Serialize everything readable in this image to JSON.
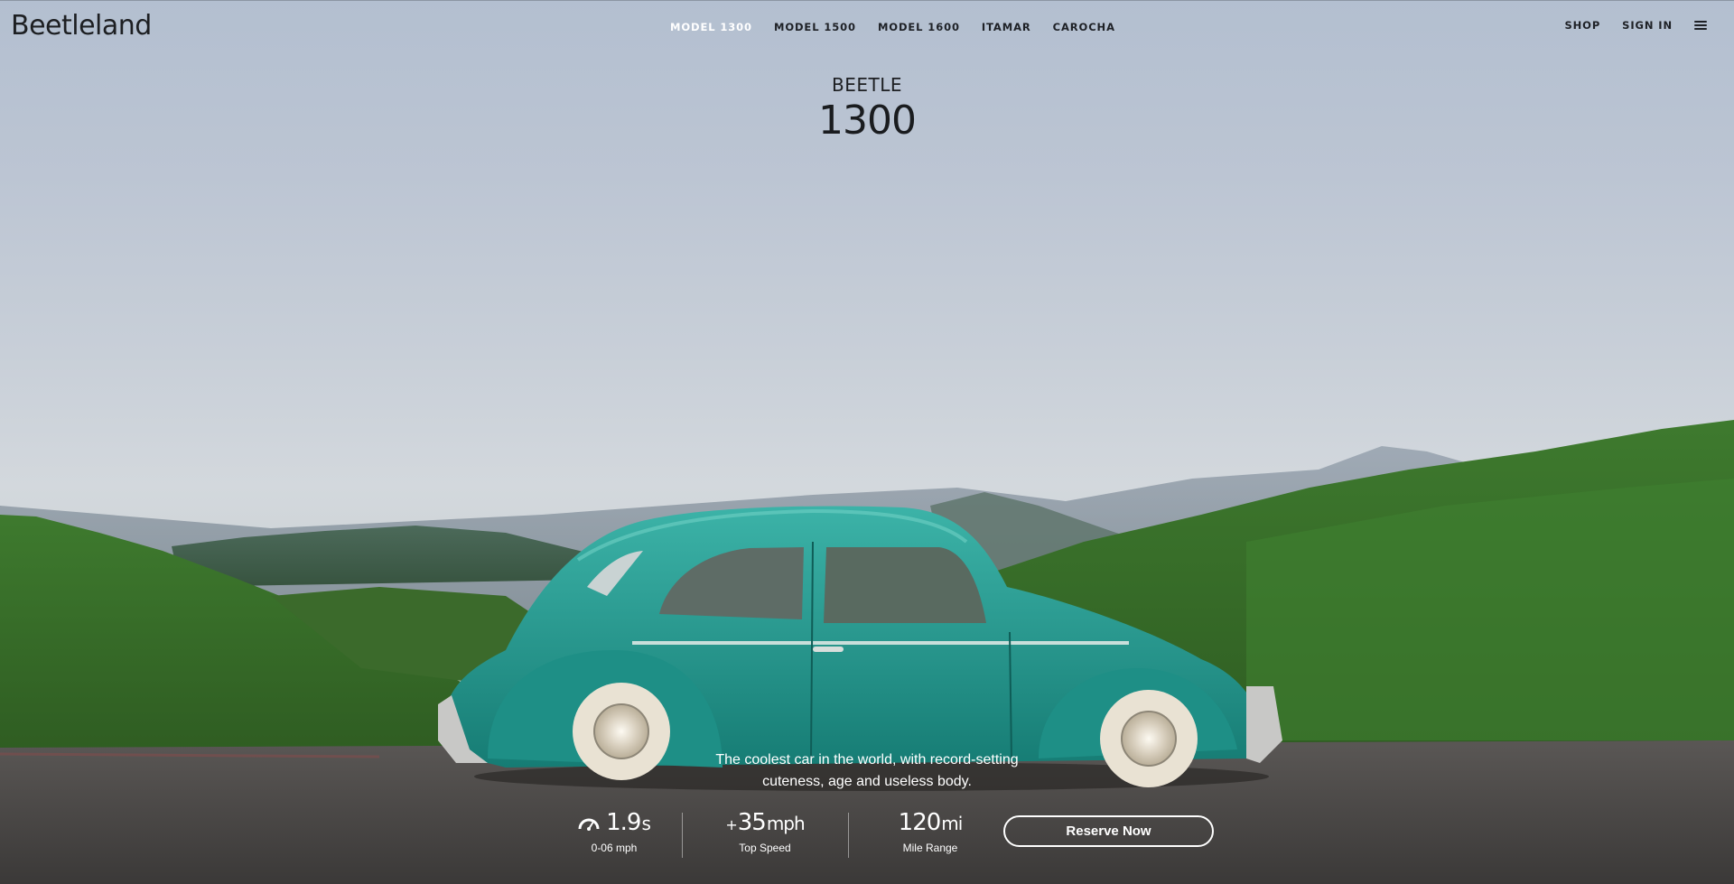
{
  "brand": {
    "name": "Beetleland"
  },
  "nav": {
    "items": [
      {
        "label": "MODEL 1300",
        "active": true
      },
      {
        "label": "MODEL 1500"
      },
      {
        "label": "MODEL 1600"
      },
      {
        "label": "ITAMAR"
      },
      {
        "label": "CAROCHA"
      }
    ]
  },
  "header_right": {
    "shop": "SHOP",
    "signin": "SIGN IN",
    "menu_icon": "hamburger-menu-icon"
  },
  "hero": {
    "subtitle": "BEETLE",
    "model_number": "1300"
  },
  "tagline": {
    "line1": "The coolest car in the world, with record-setting",
    "line2": "cuteness, age and useless body."
  },
  "stats": [
    {
      "icon": "speedometer-icon",
      "value": "1.9",
      "unit": "s",
      "label": "0-06 mph"
    },
    {
      "prefix": "+",
      "value": "35",
      "unit": "mph",
      "label": "Top Speed"
    },
    {
      "value": "120",
      "unit": "mi",
      "label": "Mile Range"
    }
  ],
  "cta": {
    "label": "Reserve Now"
  },
  "colors": {
    "car": "#2ba39a",
    "nav_active": "#ffffff",
    "text_dark": "#1d1f22"
  }
}
